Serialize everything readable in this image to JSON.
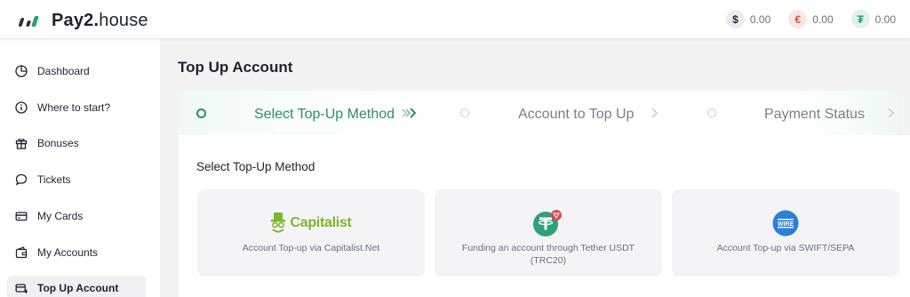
{
  "header": {
    "logo_bold": "Pay2.",
    "logo_light": "house",
    "balances": [
      {
        "symbol": "$",
        "amount": "0.00",
        "icon": "dollar-icon"
      },
      {
        "symbol": "€",
        "amount": "0.00",
        "icon": "euro-icon"
      },
      {
        "symbol": "₮",
        "amount": "0.00",
        "icon": "tether-icon"
      }
    ]
  },
  "sidebar": {
    "items": [
      {
        "label": "Dashboard",
        "icon": "pie-chart-icon"
      },
      {
        "label": "Where to start?",
        "icon": "info-icon"
      },
      {
        "label": "Bonuses",
        "icon": "gift-icon"
      },
      {
        "label": "Tickets",
        "icon": "chat-bubble-icon"
      },
      {
        "label": "My Cards",
        "icon": "card-icon"
      },
      {
        "label": "My Accounts",
        "icon": "wallet-icon"
      },
      {
        "label": "Top Up Account",
        "icon": "top-up-icon",
        "active": true
      }
    ]
  },
  "main": {
    "page_title": "Top Up Account",
    "steps": [
      {
        "label": "Select Top-Up Method",
        "active": true
      },
      {
        "label": "Account to Top Up",
        "active": false
      },
      {
        "label": "Payment Status",
        "active": false
      }
    ],
    "section_title": "Select Top-Up Method",
    "methods": [
      {
        "brand": "Capitalist",
        "caption": "Account Top-up via Capitalist.Net",
        "icon": "capitalist-logo"
      },
      {
        "brand": "",
        "caption": "Funding an account through Tether USDT (TRC20)",
        "icon": "tether-trc20-icon"
      },
      {
        "brand": "WIRE",
        "caption": "Account Top-up via SWIFT/SEPA",
        "icon": "wire-icon"
      }
    ]
  },
  "colors": {
    "accent": "#2f8d67",
    "capitalist_green": "#7cb728",
    "tether_green": "#2fa07a",
    "wire_blue": "#2c7fd6",
    "trc_red": "#e0484c"
  }
}
